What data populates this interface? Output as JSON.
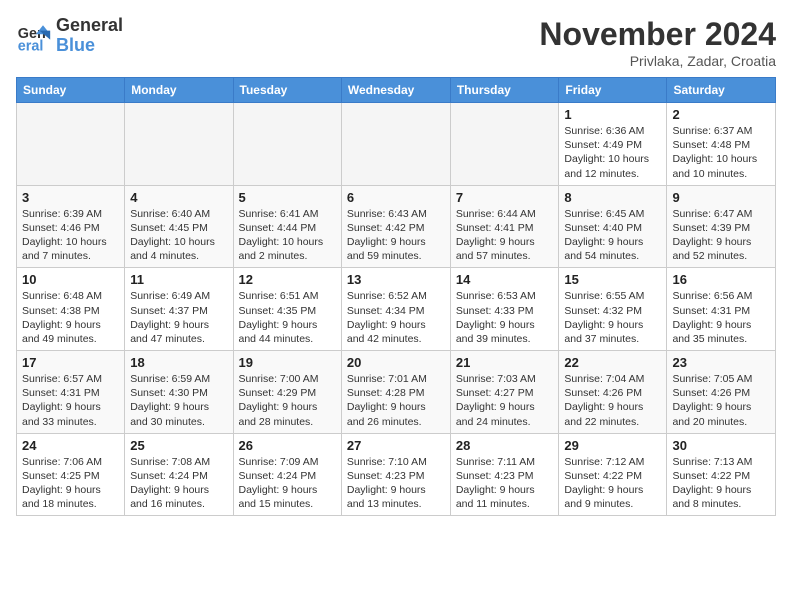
{
  "header": {
    "logo_line1": "General",
    "logo_line2": "Blue",
    "month": "November 2024",
    "location": "Privlaka, Zadar, Croatia"
  },
  "weekdays": [
    "Sunday",
    "Monday",
    "Tuesday",
    "Wednesday",
    "Thursday",
    "Friday",
    "Saturday"
  ],
  "weeks": [
    [
      {
        "day": "",
        "empty": true
      },
      {
        "day": "",
        "empty": true
      },
      {
        "day": "",
        "empty": true
      },
      {
        "day": "",
        "empty": true
      },
      {
        "day": "",
        "empty": true
      },
      {
        "day": "1",
        "sunrise": "6:36 AM",
        "sunset": "4:49 PM",
        "daylight": "10 hours and 12 minutes."
      },
      {
        "day": "2",
        "sunrise": "6:37 AM",
        "sunset": "4:48 PM",
        "daylight": "10 hours and 10 minutes."
      }
    ],
    [
      {
        "day": "3",
        "sunrise": "6:39 AM",
        "sunset": "4:46 PM",
        "daylight": "10 hours and 7 minutes."
      },
      {
        "day": "4",
        "sunrise": "6:40 AM",
        "sunset": "4:45 PM",
        "daylight": "10 hours and 4 minutes."
      },
      {
        "day": "5",
        "sunrise": "6:41 AM",
        "sunset": "4:44 PM",
        "daylight": "10 hours and 2 minutes."
      },
      {
        "day": "6",
        "sunrise": "6:43 AM",
        "sunset": "4:42 PM",
        "daylight": "9 hours and 59 minutes."
      },
      {
        "day": "7",
        "sunrise": "6:44 AM",
        "sunset": "4:41 PM",
        "daylight": "9 hours and 57 minutes."
      },
      {
        "day": "8",
        "sunrise": "6:45 AM",
        "sunset": "4:40 PM",
        "daylight": "9 hours and 54 minutes."
      },
      {
        "day": "9",
        "sunrise": "6:47 AM",
        "sunset": "4:39 PM",
        "daylight": "9 hours and 52 minutes."
      }
    ],
    [
      {
        "day": "10",
        "sunrise": "6:48 AM",
        "sunset": "4:38 PM",
        "daylight": "9 hours and 49 minutes."
      },
      {
        "day": "11",
        "sunrise": "6:49 AM",
        "sunset": "4:37 PM",
        "daylight": "9 hours and 47 minutes."
      },
      {
        "day": "12",
        "sunrise": "6:51 AM",
        "sunset": "4:35 PM",
        "daylight": "9 hours and 44 minutes."
      },
      {
        "day": "13",
        "sunrise": "6:52 AM",
        "sunset": "4:34 PM",
        "daylight": "9 hours and 42 minutes."
      },
      {
        "day": "14",
        "sunrise": "6:53 AM",
        "sunset": "4:33 PM",
        "daylight": "9 hours and 39 minutes."
      },
      {
        "day": "15",
        "sunrise": "6:55 AM",
        "sunset": "4:32 PM",
        "daylight": "9 hours and 37 minutes."
      },
      {
        "day": "16",
        "sunrise": "6:56 AM",
        "sunset": "4:31 PM",
        "daylight": "9 hours and 35 minutes."
      }
    ],
    [
      {
        "day": "17",
        "sunrise": "6:57 AM",
        "sunset": "4:31 PM",
        "daylight": "9 hours and 33 minutes."
      },
      {
        "day": "18",
        "sunrise": "6:59 AM",
        "sunset": "4:30 PM",
        "daylight": "9 hours and 30 minutes."
      },
      {
        "day": "19",
        "sunrise": "7:00 AM",
        "sunset": "4:29 PM",
        "daylight": "9 hours and 28 minutes."
      },
      {
        "day": "20",
        "sunrise": "7:01 AM",
        "sunset": "4:28 PM",
        "daylight": "9 hours and 26 minutes."
      },
      {
        "day": "21",
        "sunrise": "7:03 AM",
        "sunset": "4:27 PM",
        "daylight": "9 hours and 24 minutes."
      },
      {
        "day": "22",
        "sunrise": "7:04 AM",
        "sunset": "4:26 PM",
        "daylight": "9 hours and 22 minutes."
      },
      {
        "day": "23",
        "sunrise": "7:05 AM",
        "sunset": "4:26 PM",
        "daylight": "9 hours and 20 minutes."
      }
    ],
    [
      {
        "day": "24",
        "sunrise": "7:06 AM",
        "sunset": "4:25 PM",
        "daylight": "9 hours and 18 minutes."
      },
      {
        "day": "25",
        "sunrise": "7:08 AM",
        "sunset": "4:24 PM",
        "daylight": "9 hours and 16 minutes."
      },
      {
        "day": "26",
        "sunrise": "7:09 AM",
        "sunset": "4:24 PM",
        "daylight": "9 hours and 15 minutes."
      },
      {
        "day": "27",
        "sunrise": "7:10 AM",
        "sunset": "4:23 PM",
        "daylight": "9 hours and 13 minutes."
      },
      {
        "day": "28",
        "sunrise": "7:11 AM",
        "sunset": "4:23 PM",
        "daylight": "9 hours and 11 minutes."
      },
      {
        "day": "29",
        "sunrise": "7:12 AM",
        "sunset": "4:22 PM",
        "daylight": "9 hours and 9 minutes."
      },
      {
        "day": "30",
        "sunrise": "7:13 AM",
        "sunset": "4:22 PM",
        "daylight": "9 hours and 8 minutes."
      }
    ]
  ]
}
